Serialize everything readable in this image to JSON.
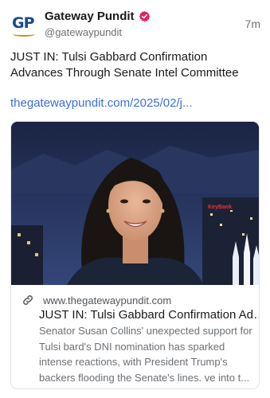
{
  "author": {
    "display_name": "Gateway Pundit",
    "handle": "@gatewaypundit",
    "avatar_text": "GP",
    "verified_color": "#e0245e"
  },
  "post": {
    "timestamp": "7m",
    "text": "JUST IN: Tulsi Gabbard Confirmation Advances Through Senate Intel Committee",
    "link_text": "thegatewaypundit.com/2025/02/j...",
    "link_color": "#3b6fd8"
  },
  "card": {
    "domain": "www.thegatewaypundit.com",
    "title": "JUST IN: Tulsi Gabbard Confirmation Advances Through Senate Intel Committee",
    "description": "Senator Susan Collins' unexpected support for Tulsi bard's DNI nomination has sparked intense reactions, with President Trump's backers flooding the Senate's lines. ve into t...",
    "image_sign_text": "KeyBank",
    "image_icon": "person-portrait-image"
  }
}
